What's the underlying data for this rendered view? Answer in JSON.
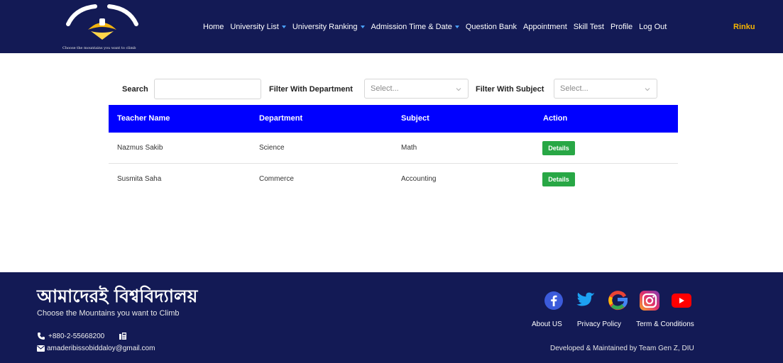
{
  "nav": {
    "logo_slogan": "Choose the mountains you want to climb",
    "items": [
      {
        "label": "Home",
        "dropdown": false
      },
      {
        "label": "University List",
        "dropdown": true
      },
      {
        "label": "University Ranking",
        "dropdown": true
      },
      {
        "label": "Admission Time & Date",
        "dropdown": true
      },
      {
        "label": "Question Bank",
        "dropdown": false
      },
      {
        "label": "Appointment",
        "dropdown": false
      },
      {
        "label": "Skill Test",
        "dropdown": false
      },
      {
        "label": "Profile",
        "dropdown": false
      },
      {
        "label": "Log Out",
        "dropdown": false
      }
    ],
    "user": "Rinku"
  },
  "filters": {
    "search_label": "Search",
    "search_value": "",
    "department_label": "Filter With Department",
    "department_placeholder": "Select...",
    "subject_label": "Filter With Subject",
    "subject_placeholder": "Select..."
  },
  "table": {
    "headers": [
      "Teacher Name",
      "Department",
      "Subject",
      "Action"
    ],
    "rows": [
      {
        "name": "Nazmus Sakib",
        "department": "Science",
        "subject": "Math",
        "action": "Details"
      },
      {
        "name": "Susmita Saha",
        "department": "Commerce",
        "subject": "Accounting",
        "action": "Details"
      }
    ]
  },
  "footer": {
    "brand": "আমাদেরই বিশ্ববিদ্যালয়",
    "tagline": "Choose the Mountains you want to Climb",
    "phone": "+880-2-55668200",
    "email": "amaderibissobiddaloy@gmail.com",
    "links": [
      "About US",
      "Privacy Policy",
      "Term & Conditions"
    ],
    "developed": "Developed & Maintained by Team Gen Z, DIU"
  },
  "colors": {
    "navbar_bg": "#131a55",
    "table_header_bg": "#0000ff",
    "details_button": "#28a745",
    "user_name": "#f7b500",
    "dropdown_caret": "#4aa3ff"
  },
  "icons": [
    "logo-icon",
    "chevron-down-icon",
    "phone-icon",
    "fax-icon",
    "email-icon",
    "facebook-icon",
    "twitter-icon",
    "google-icon",
    "instagram-icon",
    "youtube-icon"
  ]
}
